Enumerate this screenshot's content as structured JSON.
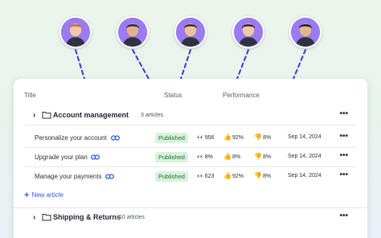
{
  "colors": {
    "accent": "#2d5fd6",
    "avatar_bg": "#9b7bf0",
    "connector": "#4b33c9",
    "published_bg": "#d9f2dc",
    "published_text": "#1f6b33"
  },
  "avatars": [
    {
      "name": "avatar-1",
      "hair": "#c96b3a",
      "skin": "#f1c7a6"
    },
    {
      "name": "avatar-2",
      "hair": "#2a2a2a",
      "skin": "#e3b08f"
    },
    {
      "name": "avatar-3",
      "hair": "#3a2a1f",
      "skin": "#efc09c"
    },
    {
      "name": "avatar-4",
      "hair": "#2e2420",
      "skin": "#f0c9a8"
    },
    {
      "name": "avatar-5",
      "hair": "#1f1f1f",
      "skin": "#e6b48e"
    }
  ],
  "table": {
    "headers": {
      "title": "Title",
      "status": "Status",
      "performance": "Performance"
    }
  },
  "groups": [
    {
      "title": "Account management",
      "count": "3 articles",
      "more": "•••",
      "articles": [
        {
          "title": "Personalize your account",
          "status": "Published",
          "views": "956",
          "positive": "92%",
          "negative": "8%",
          "date": "Sep 14, 2024"
        },
        {
          "title": "Upgrade your plan",
          "status": "Published",
          "views": "8%",
          "positive": "8%",
          "negative": "8%",
          "date": "Sep 14, 2024"
        },
        {
          "title": "Manage your payments",
          "status": "Published",
          "views": "623",
          "positive": "92%",
          "negative": "8%",
          "date": "Sep 14, 2024"
        }
      ],
      "new_article_label": "New article"
    },
    {
      "title": "Shipping & Returns",
      "count": "10 articles",
      "more": "•••"
    }
  ]
}
